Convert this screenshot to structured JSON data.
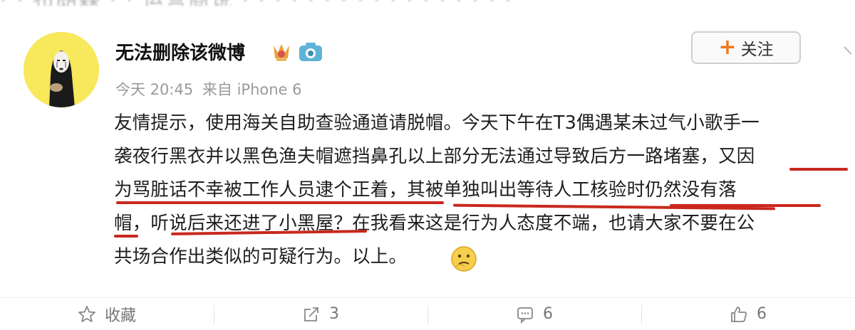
{
  "post": {
    "username": "无法删除该微博",
    "meta": {
      "time": "今天 20:45",
      "source": "来自 iPhone 6"
    },
    "follow_label": "关注",
    "content_lines": [
      "友情提示，使用海关自助查验通道请脱帽。今天下午在T3偶遇某未过气小歌手一",
      "袭夜行黑衣并以黑色渔夫帽遮挡鼻孔以上部分无法通过导致后方一路堵塞，又因",
      "为骂脏话不幸被工作人员逮个正着，其被单独叫出等待人工核验时仍然没有落",
      "帽，听说后来还进了小黑屋？在我看来这是行为人态度不端，也请大家不要在公",
      "共场合作出类似的可疑行为。以上。"
    ],
    "emoji_icon": "thinking-face-icon",
    "highlight_color": "#c9281e"
  },
  "actions": {
    "favorite_label": "收藏",
    "repost_count": "3",
    "comment_count": "6",
    "like_count": "6"
  },
  "icons": {
    "favorite": "star-icon",
    "repost": "share-icon",
    "comment": "comment-icon",
    "like": "thumbs-up-icon",
    "vip": "vip-badge-icon",
    "camera": "camera-badge-icon"
  },
  "colors": {
    "follow_plus": "#f07a1a",
    "meta_text": "#9a9a9a"
  }
}
